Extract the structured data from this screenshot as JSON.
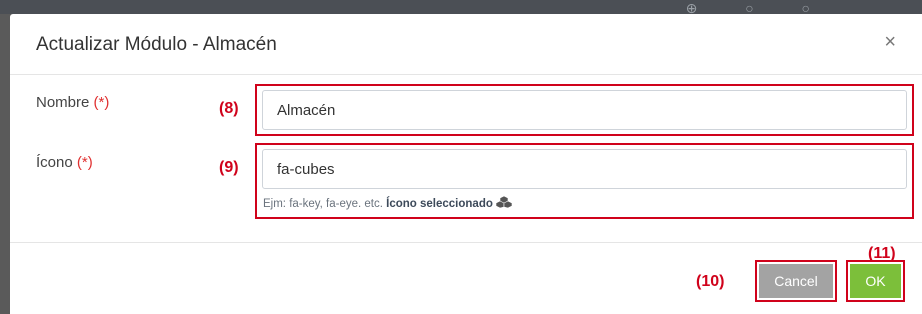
{
  "modal": {
    "title": "Actualizar Módulo - Almacén",
    "close_glyph": "×"
  },
  "form": {
    "nombre": {
      "label": "Nombre",
      "required_mark": "(*)",
      "value": "Almacén",
      "marker": "(8)"
    },
    "icono": {
      "label": "Ícono",
      "required_mark": "(*)",
      "value": "fa-cubes",
      "marker": "(9)",
      "help_text": "Ejm: fa-key, fa-eye. etc.",
      "help_selected": "Ícono seleccionado",
      "selected_icon": "cubes-icon"
    }
  },
  "footer": {
    "cancel_label": "Cancel",
    "ok_label": "OK",
    "cancel_marker": "(10)",
    "ok_marker": "(11)"
  },
  "colors": {
    "highlight": "#d0021b",
    "cancel_bg": "#a3a3a3",
    "ok_bg": "#7cbf3a",
    "required": "#e03030"
  }
}
